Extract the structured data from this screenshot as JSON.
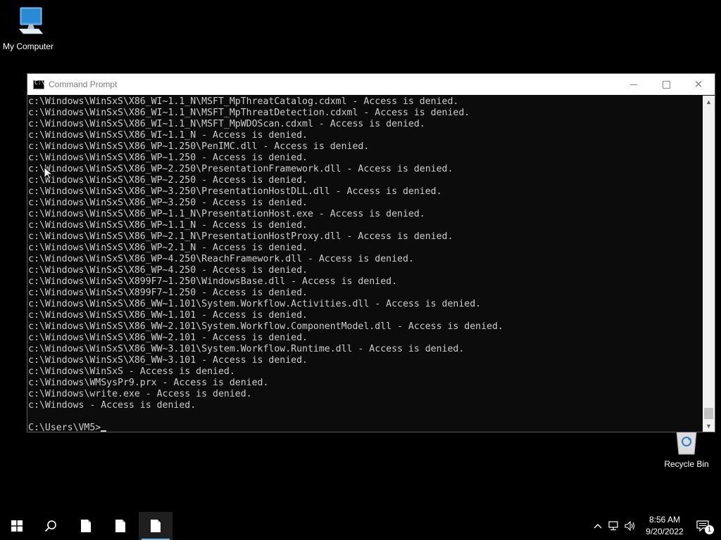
{
  "desktop": {
    "icons": [
      {
        "label": "My Computer",
        "icon": "computer-icon"
      },
      {
        "label": "Recycle Bin",
        "icon": "recycle-bin-icon"
      }
    ]
  },
  "window": {
    "title": "Command Prompt",
    "icon": "cmd-icon",
    "controls": [
      "minimize-icon",
      "maximize-icon",
      "close-icon"
    ]
  },
  "console": {
    "lines": [
      "c:\\Windows\\WinSxS\\X86_WI~1.1_N\\MSFT_MpThreatCatalog.cdxml - Access is denied.",
      "c:\\Windows\\WinSxS\\X86_WI~1.1_N\\MSFT_MpThreatDetection.cdxml - Access is denied.",
      "c:\\Windows\\WinSxS\\X86_WI~1.1_N\\MSFT_MpWDOScan.cdxml - Access is denied.",
      "c:\\Windows\\WinSxS\\X86_WI~1.1_N - Access is denied.",
      "c:\\Windows\\WinSxS\\X86_WP~1.250\\PenIMC.dll - Access is denied.",
      "c:\\Windows\\WinSxS\\X86_WP~1.250 - Access is denied.",
      "c:\\Windows\\WinSxS\\X86_WP~2.250\\PresentationFramework.dll - Access is denied.",
      "c:\\Windows\\WinSxS\\X86_WP~2.250 - Access is denied.",
      "c:\\Windows\\WinSxS\\X86_WP~3.250\\PresentationHostDLL.dll - Access is denied.",
      "c:\\Windows\\WinSxS\\X86_WP~3.250 - Access is denied.",
      "c:\\Windows\\WinSxS\\X86_WP~1.1_N\\PresentationHost.exe - Access is denied.",
      "c:\\Windows\\WinSxS\\X86_WP~1.1_N - Access is denied.",
      "c:\\Windows\\WinSxS\\X86_WP~2.1_N\\PresentationHostProxy.dll - Access is denied.",
      "c:\\Windows\\WinSxS\\X86_WP~2.1_N - Access is denied.",
      "c:\\Windows\\WinSxS\\X86_WP~4.250\\ReachFramework.dll - Access is denied.",
      "c:\\Windows\\WinSxS\\X86_WP~4.250 - Access is denied.",
      "c:\\Windows\\WinSxS\\X899F7~1.250\\WindowsBase.dll - Access is denied.",
      "c:\\Windows\\WinSxS\\X899F7~1.250 - Access is denied.",
      "c:\\Windows\\WinSxS\\X86_WW~1.101\\System.Workflow.Activities.dll - Access is denied.",
      "c:\\Windows\\WinSxS\\X86_WW~1.101 - Access is denied.",
      "c:\\Windows\\WinSxS\\X86_WW~2.101\\System.Workflow.ComponentModel.dll - Access is denied.",
      "c:\\Windows\\WinSxS\\X86_WW~2.101 - Access is denied.",
      "c:\\Windows\\WinSxS\\X86_WW~3.101\\System.Workflow.Runtime.dll - Access is denied.",
      "c:\\Windows\\WinSxS\\X86_WW~3.101 - Access is denied.",
      "c:\\Windows\\WinSxS - Access is denied.",
      "c:\\Windows\\WMSysPr9.prx - Access is denied.",
      "c:\\Windows\\write.exe - Access is denied.",
      "c:\\Windows - Access is denied."
    ],
    "prompt": "C:\\Users\\VM5>",
    "text_color": "#cccccc",
    "background_color": "#0c0c0c"
  },
  "taskbar": {
    "start_icon": "windows-start-icon",
    "search_icon": "search-icon",
    "apps": [
      "file-icon",
      "file-icon",
      "file-icon"
    ],
    "tray": {
      "icons": [
        "chevron-up-icon",
        "network-icon",
        "volume-icon"
      ],
      "time": "8:56 AM",
      "date": "9/20/2022",
      "notification_count": "1"
    },
    "active_indicator_color": "#76b9ed"
  }
}
